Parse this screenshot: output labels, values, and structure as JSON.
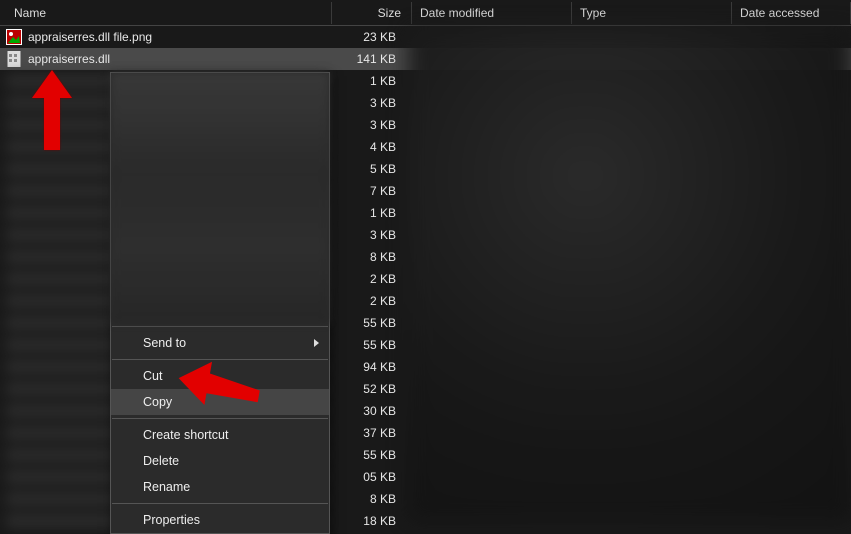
{
  "columns": {
    "name": "Name",
    "size": "Size",
    "date": "Date modified",
    "type": "Type",
    "accessed": "Date accessed"
  },
  "files": [
    {
      "name": "appraiserres.dll file.png",
      "size": "23 KB"
    },
    {
      "name": "appraiserres.dll",
      "size": "141 KB"
    }
  ],
  "hidden_sizes": [
    "1 KB",
    "3 KB",
    "3 KB",
    "4 KB",
    "5 KB",
    "7 KB",
    "1 KB",
    "3 KB",
    "8 KB",
    "2 KB",
    "2 KB",
    "55 KB",
    "55 KB",
    "94 KB",
    "52 KB",
    "30 KB",
    "37 KB",
    "55 KB",
    "05 KB",
    "8 KB",
    "18 KB"
  ],
  "context_menu": {
    "send_to": "Send to",
    "cut": "Cut",
    "copy": "Copy",
    "create_shortcut": "Create shortcut",
    "delete": "Delete",
    "rename": "Rename",
    "properties": "Properties"
  }
}
